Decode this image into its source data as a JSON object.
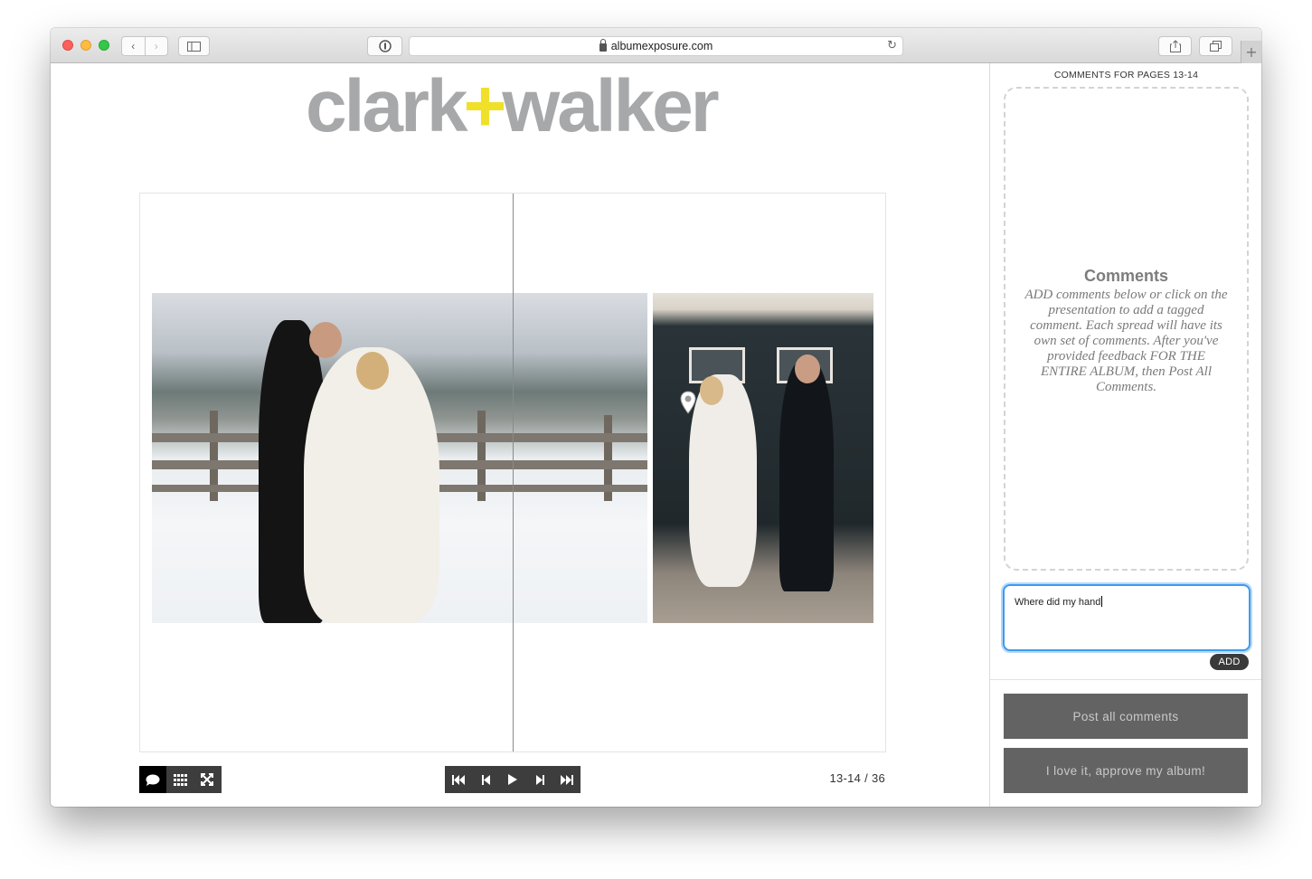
{
  "browser": {
    "url": "albumexposure.com"
  },
  "logo": {
    "left": "clark",
    "plus": "+",
    "right": "walker"
  },
  "viewer": {
    "page_count": "13-14 / 36"
  },
  "sidebar": {
    "title": "COMMENTS FOR PAGES 13-14",
    "placeholder_heading": "Comments",
    "placeholder_text": "ADD comments below or click on the presentation to add a tagged comment. Each spread will have its own set of comments. After you've provided feedback FOR THE ENTIRE ALBUM, then Post All Comments.",
    "input_value": "Where did my hand",
    "add_label": "ADD",
    "post_label": "Post all comments",
    "approve_label": "I love it, approve my album!"
  },
  "colors": {
    "logo_gray": "#a7a8aa",
    "logo_plus": "#f0e02a",
    "button_gray": "#636363",
    "input_focus": "#3d9bf0"
  }
}
